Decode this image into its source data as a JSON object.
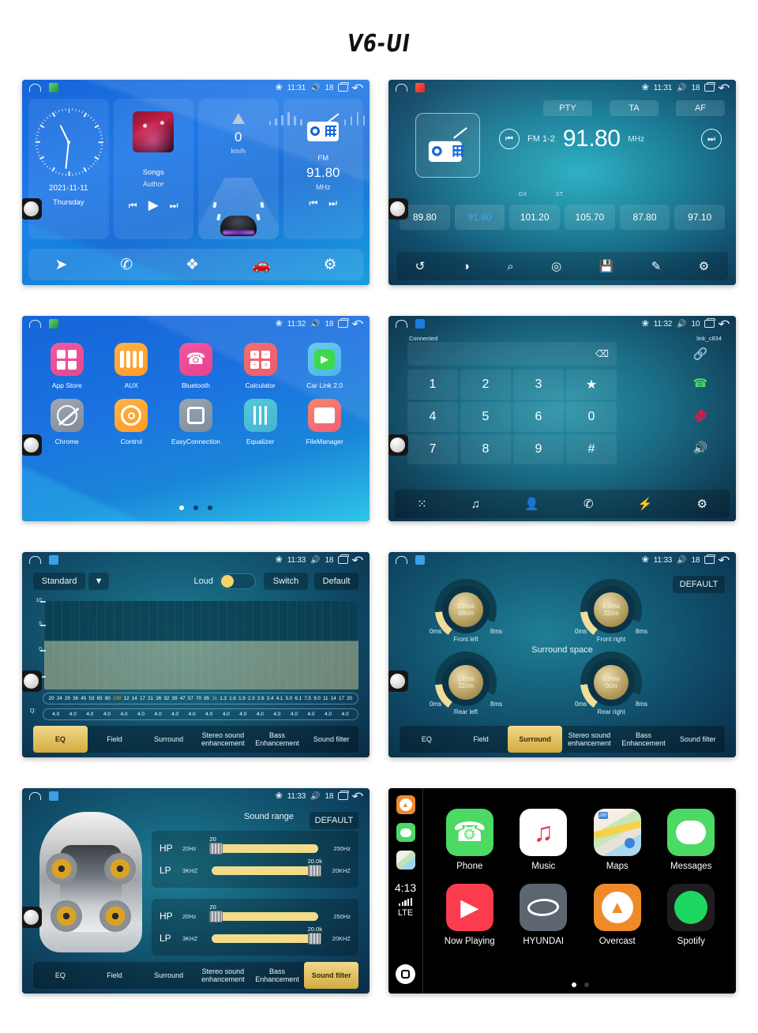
{
  "page": {
    "title": "V6-UI"
  },
  "status_common": {
    "home_icon": "home-outline-icon",
    "bluetooth_icon": "bluetooth-icon",
    "volume_icon": "volume-icon",
    "recents_icon": "recents-icon",
    "back_icon": "back-arrow-icon"
  },
  "screens": {
    "home": {
      "status": {
        "time": "11:31",
        "volume": "18"
      },
      "clock": {
        "date": "2021-11-11",
        "weekday": "Thursday"
      },
      "music": {
        "title": "Songs",
        "author": "Author",
        "prev": "⏮",
        "play": "▶",
        "next": "⏭"
      },
      "speed": {
        "value": "0",
        "unit": "km/h"
      },
      "radio": {
        "band": "FM",
        "frequency": "91.80",
        "unit": "MHz",
        "prev": "⏮",
        "next": "⏭"
      },
      "dock": [
        {
          "name": "navigation-icon",
          "glyph": "➤"
        },
        {
          "name": "phone-icon",
          "glyph": "✆"
        },
        {
          "name": "apps-icon",
          "glyph": "❖"
        },
        {
          "name": "carlink-icon",
          "glyph": "🚗"
        },
        {
          "name": "settings-icon",
          "glyph": "⚙"
        }
      ]
    },
    "radio": {
      "status": {
        "time": "11:31",
        "volume": "18"
      },
      "top_buttons": [
        "PTY",
        "TA",
        "AF"
      ],
      "band": "FM 1-2",
      "frequency": "91.80",
      "unit": "MHz",
      "prev": "⏮",
      "next": "⏭",
      "dx": "DX",
      "st": "ST",
      "presets": [
        {
          "value": "89.80",
          "active": false
        },
        {
          "value": "91.80",
          "active": true
        },
        {
          "value": "101.20",
          "active": false
        },
        {
          "value": "105.70",
          "active": false
        },
        {
          "value": "87.80",
          "active": false
        },
        {
          "value": "97.10",
          "active": false
        }
      ],
      "toolbar": [
        {
          "name": "band-switch-icon",
          "glyph": "↺"
        },
        {
          "name": "stereo-toggle-icon",
          "glyph": "◑"
        },
        {
          "name": "search-icon",
          "glyph": "⌕"
        },
        {
          "name": "scan-icon",
          "glyph": "◎"
        },
        {
          "name": "save-icon",
          "glyph": "💾"
        },
        {
          "name": "edit-icon",
          "glyph": "✎"
        },
        {
          "name": "settings-icon",
          "glyph": "⚙"
        }
      ]
    },
    "apps": {
      "status": {
        "time": "11:32",
        "volume": "18"
      },
      "items": [
        {
          "label": "App Store",
          "icon": "app-store-icon",
          "color1": "#ef59a3",
          "color2": "#e7478f"
        },
        {
          "label": "AUX",
          "icon": "aux-icon",
          "color1": "#ffb347",
          "color2": "#ff9b24"
        },
        {
          "label": "Bluetooth",
          "icon": "bluetooth-phone-icon",
          "color1": "#f0579f",
          "color2": "#e8418d"
        },
        {
          "label": "Calculator",
          "icon": "calculator-icon",
          "color1": "#f2706e",
          "color2": "#ef5a70"
        },
        {
          "label": "Car Link 2.0",
          "icon": "car-link-icon",
          "color1": "#6ec9f0",
          "color2": "#4ab7e8"
        },
        {
          "label": "Chrome",
          "icon": "chrome-icon",
          "color1": "#9fa9b6",
          "color2": "#7f8a99"
        },
        {
          "label": "Control",
          "icon": "steering-wheel-icon",
          "color1": "#ffb347",
          "color2": "#ff9b24"
        },
        {
          "label": "EasyConnection",
          "icon": "easy-connection-icon",
          "color1": "#9aa6b4",
          "color2": "#7d8b9b"
        },
        {
          "label": "Equalizer",
          "icon": "equalizer-icon",
          "color1": "#57c7da",
          "color2": "#3fb6d2"
        },
        {
          "label": "FileManager",
          "icon": "file-manager-icon",
          "color1": "#f4876a",
          "color2": "#ef5f7a"
        }
      ],
      "page_dots": [
        true,
        false,
        false
      ]
    },
    "bluetooth": {
      "status": {
        "time": "11:32",
        "volume": "10"
      },
      "connection_status": "Connected",
      "device_name": "link_c834",
      "dial_value": "",
      "backspace_icon": "backspace-icon",
      "keys": [
        "1",
        "2",
        "3",
        "★",
        "4",
        "5",
        "6",
        "0",
        "7",
        "8",
        "9",
        "#"
      ],
      "side_keys": [
        {
          "name": "link-icon",
          "glyph": "🔗"
        },
        {
          "name": "call-answer-icon",
          "glyph": "✆"
        },
        {
          "name": "call-end-icon",
          "glyph": "✆"
        },
        {
          "name": "speaker-icon",
          "glyph": "🔊"
        }
      ],
      "toolbar": [
        {
          "name": "dialpad-icon",
          "glyph": "⁙"
        },
        {
          "name": "music-icon",
          "glyph": "♫"
        },
        {
          "name": "contacts-icon",
          "glyph": "👤"
        },
        {
          "name": "call-history-icon",
          "glyph": "✆"
        },
        {
          "name": "disconnect-icon",
          "glyph": "⚡"
        },
        {
          "name": "settings-icon",
          "glyph": "⚙"
        }
      ]
    },
    "equalizer": {
      "status": {
        "time": "11:33",
        "volume": "18"
      },
      "preset": "Standard",
      "dropdown_icon": "chevron-down-icon",
      "loud_label": "Loud",
      "loud_on": true,
      "switch_label": "Switch",
      "default_label": "Default",
      "y_ticks": [
        "10",
        "5",
        "0",
        "-5"
      ],
      "q_label": "Q:",
      "frequencies": [
        "20",
        "24",
        "29",
        "36",
        "45",
        "53",
        "65",
        "80",
        "100",
        "12",
        "14",
        "17",
        "21",
        "26",
        "32",
        "39",
        "47",
        "57",
        "70",
        "85",
        "1k",
        "1.3",
        "1.6",
        "1.9",
        "2.3",
        "2.8",
        "3.4",
        "4.1",
        "5.0",
        "6.1",
        "7.5",
        "9.0",
        "11",
        "14",
        "17",
        "20"
      ],
      "highlight_frequencies": [
        "100",
        "1k"
      ],
      "q_values": [
        "4.0",
        "4.0",
        "4.0",
        "4.0",
        "4.0",
        "4.0",
        "4.0",
        "4.0",
        "4.0",
        "4.0",
        "4.0",
        "4.0",
        "4.0",
        "4.0",
        "4.0",
        "4.0",
        "4.0",
        "4.0"
      ],
      "tabs": [
        {
          "label": "EQ",
          "active": true
        },
        {
          "label": "Field",
          "active": false
        },
        {
          "label": "Surround",
          "active": false
        },
        {
          "label": "Stereo sound enhancement",
          "active": false
        },
        {
          "label": "Bass Enhancement",
          "active": false
        },
        {
          "label": "Sound filter",
          "active": false
        }
      ]
    },
    "surround": {
      "status": {
        "time": "11:33",
        "volume": "18"
      },
      "default_label": "DEFAULT",
      "title": "Surround space",
      "knobs": [
        {
          "name": "Front left",
          "delay": "2.0ms",
          "distance": "68cm",
          "min": "0ms",
          "max": "8ms",
          "angle": 28
        },
        {
          "name": "Front right",
          "delay": "1.0ms",
          "distance": "32cm",
          "min": "0ms",
          "max": "8ms",
          "angle": 14
        },
        {
          "name": "Rear left",
          "delay": "1.0ms",
          "distance": "32cm",
          "min": "0ms",
          "max": "8ms",
          "angle": 14
        },
        {
          "name": "Rear right",
          "delay": "0.0ms",
          "distance": "0cm",
          "min": "0ms",
          "max": "8ms",
          "angle": 3
        }
      ],
      "tabs": [
        {
          "label": "EQ",
          "active": false
        },
        {
          "label": "Field",
          "active": false
        },
        {
          "label": "Surround",
          "active": true
        },
        {
          "label": "Stereo sound enhancement",
          "active": false
        },
        {
          "label": "Bass Enhancement",
          "active": false
        },
        {
          "label": "Sound filter",
          "active": false
        }
      ]
    },
    "sound_filter": {
      "status": {
        "time": "11:33",
        "volume": "18"
      },
      "title": "Sound range",
      "default_label": "DEFAULT",
      "panels": [
        {
          "rows": [
            {
              "type": "HP",
              "min": "20Hz",
              "max": "250Hz",
              "value": "20",
              "pos": 4
            },
            {
              "type": "LP",
              "min": "3KHZ",
              "max": "20KHZ",
              "value": "20.0k",
              "pos": 96
            }
          ]
        },
        {
          "rows": [
            {
              "type": "HP",
              "min": "20Hz",
              "max": "250Hz",
              "value": "20",
              "pos": 4
            },
            {
              "type": "LP",
              "min": "3KHZ",
              "max": "20KHZ",
              "value": "20.0k",
              "pos": 96
            }
          ]
        }
      ],
      "tabs": [
        {
          "label": "EQ",
          "active": false
        },
        {
          "label": "Field",
          "active": false
        },
        {
          "label": "Surround",
          "active": false
        },
        {
          "label": "Stereo sound enhancement",
          "active": false
        },
        {
          "label": "Bass Enhancement",
          "active": false
        },
        {
          "label": "Sound filter",
          "active": true
        }
      ]
    },
    "carplay": {
      "sidebar": {
        "icons": [
          {
            "name": "overcast-icon",
            "color": "#ef8a2a"
          },
          {
            "name": "messages-icon",
            "color": "#4cd964"
          },
          {
            "name": "maps-icon",
            "color": "#e8e3d8"
          }
        ],
        "time": "4:13",
        "signal_icon": "signal-bars-icon",
        "network": "LTE",
        "home_icon": "carplay-home-icon"
      },
      "apps": [
        {
          "label": "Phone",
          "icon": "phone-icon"
        },
        {
          "label": "Music",
          "icon": "music-icon"
        },
        {
          "label": "Maps",
          "icon": "maps-icon"
        },
        {
          "label": "Messages",
          "icon": "messages-icon"
        },
        {
          "label": "Now Playing",
          "icon": "now-playing-icon"
        },
        {
          "label": "HYUNDAI",
          "icon": "hyundai-icon"
        },
        {
          "label": "Overcast",
          "icon": "overcast-icon"
        },
        {
          "label": "Spotify",
          "icon": "spotify-icon"
        }
      ],
      "page_dots": [
        true,
        false
      ]
    }
  }
}
